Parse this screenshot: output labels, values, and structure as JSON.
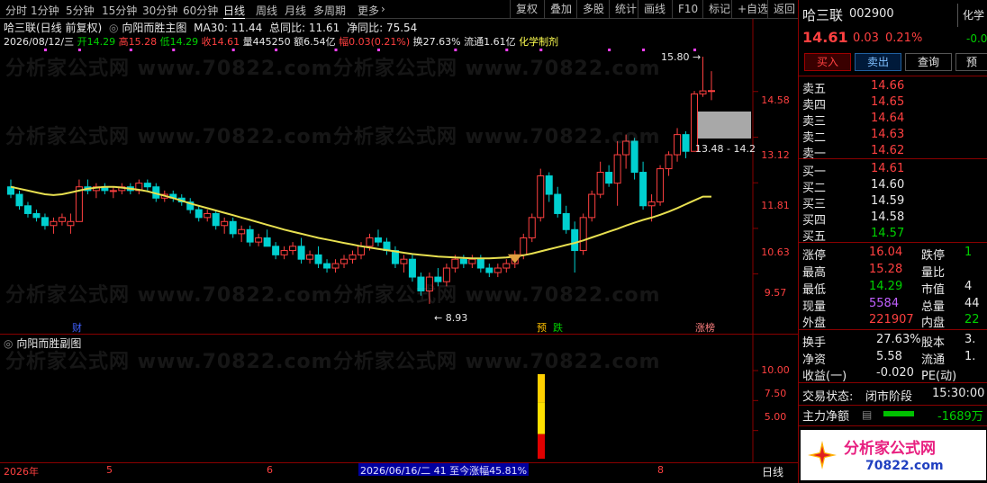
{
  "toolbar": {
    "timeframes": [
      "分时",
      "1分钟",
      "5分钟",
      "15分钟",
      "30分钟",
      "60分钟",
      "日线",
      "周线",
      "月线",
      "多周期",
      "更多"
    ],
    "active_timeframe": "日线",
    "buttons": [
      "复权",
      "叠加",
      "多股",
      "统计",
      "画线",
      "F10",
      "标记",
      "+自选",
      "返回"
    ]
  },
  "main": {
    "title": "哈三联(日线 前复权)",
    "indicator_name": "向阳而胜主图",
    "ma30": "MA30: 11.44",
    "total_ratio": "总同比: 11.61",
    "net_ratio": "净同比: 75.54",
    "info_date": "2026/08/12/三",
    "info_open_label": "开",
    "info_open": "14.29",
    "info_high_label": "高",
    "info_high": "15.28",
    "info_low_label": "低",
    "info_low": "14.29",
    "info_close_label": "收",
    "info_close": "14.61",
    "info_vol": "量445250",
    "info_amount": "额6.54亿",
    "info_amp": "幅0.03(0.21%)",
    "info_turnover": "换27.63%",
    "info_float": "流通1.61亿",
    "info_industry": "化学制剂",
    "y_labels": [
      "14.58",
      "13.12",
      "11.81",
      "10.63",
      "9.57"
    ],
    "high_marker": "15.80",
    "low_marker": "8.93",
    "range_label": "13.48 - 14.2",
    "tag_cai": "财",
    "tag_yu": "预",
    "tag_die": "跌",
    "tag_zhangbang": "涨榜"
  },
  "watermarks": [
    "分析家公式网 www.70822.com",
    "分析家公式网 www.70822.com",
    "分析家公式网 www.70822.com",
    "分析家公式网 www.70822.com",
    "分析家公式网 www.70822.com",
    "分析家公式网 www.70822.com",
    "分析家公式网 www.70822.com",
    "分析家公式网 www.70822.com"
  ],
  "sub": {
    "title": "向阳而胜副图",
    "y_labels": [
      "10.00",
      "7.50",
      "5.00"
    ]
  },
  "bottom": {
    "year_label": "2026年",
    "month_labels": [
      "5",
      "6",
      "8"
    ],
    "cursor_label": "2026/06/16/二 41 至今涨幅45.81%",
    "period": "日线"
  },
  "quote": {
    "name": "哈三联",
    "code": "002900",
    "price": "14.61",
    "change": "0.03",
    "change_pct": "0.21%",
    "buttons": [
      "买入",
      "卖出",
      "查询",
      "预"
    ],
    "side_tab": "化学",
    "side_tab_value": "-0.0",
    "sells": [
      {
        "label": "卖五",
        "price": "14.66"
      },
      {
        "label": "卖四",
        "price": "14.65"
      },
      {
        "label": "卖三",
        "price": "14.64"
      },
      {
        "label": "卖二",
        "price": "14.63"
      },
      {
        "label": "卖一",
        "price": "14.62"
      }
    ],
    "buys": [
      {
        "label": "买一",
        "price": "14.61"
      },
      {
        "label": "买二",
        "price": "14.60"
      },
      {
        "label": "买三",
        "price": "14.59"
      },
      {
        "label": "买四",
        "price": "14.58"
      },
      {
        "label": "买五",
        "price": "14.57"
      }
    ],
    "stats": [
      {
        "l1": "涨停",
        "v1": "16.04",
        "l2": "跌停",
        "v2": "1"
      },
      {
        "l1": "最高",
        "v1": "15.28",
        "l2": "量比",
        "v2": ""
      },
      {
        "l1": "最低",
        "v1": "14.29",
        "l2": "市值",
        "v2": "4"
      },
      {
        "l1": "现量",
        "v1": "5584",
        "l2": "总量",
        "v2": "44"
      },
      {
        "l1": "外盘",
        "v1": "221907",
        "l2": "内盘",
        "v2": "22"
      }
    ],
    "stats2": [
      {
        "l1": "换手",
        "v1": "27.63%",
        "l2": "股本",
        "v2": "3."
      },
      {
        "l1": "净资",
        "v1": "5.58",
        "l2": "流通",
        "v2": "1."
      },
      {
        "l1": "收益(一)",
        "v1": "-0.020",
        "l2": "PE(动)",
        "v2": ""
      }
    ],
    "trade_state_label": "交易状态:",
    "trade_state": "闭市阶段",
    "trade_time": "15:30:00",
    "main_flow_label": "主力净额",
    "main_flow": "-1689万"
  },
  "logo": {
    "text": "分析家公式网",
    "url_text": "70822.com"
  },
  "colors": {
    "up": "#ff4040",
    "down": "#00d0d0",
    "ma": "#e8e050",
    "border": "#8a0000"
  },
  "chart_data": {
    "type": "candlestick",
    "ma30_latest": 11.44,
    "high_marker": 15.8,
    "low_marker": 8.93,
    "candles": [
      [
        11.7,
        11.9,
        11.4,
        11.5
      ],
      [
        11.5,
        11.6,
        11.1,
        11.2
      ],
      [
        11.2,
        11.3,
        10.9,
        11.0
      ],
      [
        11.0,
        11.1,
        10.8,
        10.9
      ],
      [
        10.9,
        11.0,
        10.6,
        10.7
      ],
      [
        10.7,
        10.9,
        10.5,
        10.8
      ],
      [
        10.8,
        11.0,
        10.7,
        10.9
      ],
      [
        10.7,
        11.0,
        10.5,
        10.8
      ],
      [
        10.8,
        11.9,
        10.8,
        11.7
      ],
      [
        11.7,
        11.9,
        11.5,
        11.6
      ],
      [
        11.6,
        11.8,
        11.4,
        11.7
      ],
      [
        11.7,
        11.8,
        11.5,
        11.6
      ],
      [
        11.6,
        11.7,
        11.4,
        11.6
      ],
      [
        11.6,
        11.8,
        11.5,
        11.7
      ],
      [
        11.7,
        11.8,
        11.5,
        11.6
      ],
      [
        11.6,
        11.9,
        11.5,
        11.8
      ],
      [
        11.8,
        11.9,
        11.6,
        11.7
      ],
      [
        11.7,
        11.8,
        11.3,
        11.4
      ],
      [
        11.4,
        11.6,
        11.3,
        11.5
      ],
      [
        11.5,
        11.6,
        11.3,
        11.4
      ],
      [
        11.4,
        11.5,
        11.2,
        11.3
      ],
      [
        11.3,
        11.4,
        11.0,
        11.1
      ],
      [
        11.1,
        11.2,
        10.8,
        10.9
      ],
      [
        10.9,
        11.1,
        10.8,
        11.0
      ],
      [
        11.0,
        11.1,
        10.6,
        10.7
      ],
      [
        10.7,
        10.9,
        10.5,
        10.8
      ],
      [
        10.8,
        10.9,
        10.4,
        10.5
      ],
      [
        10.5,
        10.7,
        10.3,
        10.6
      ],
      [
        10.6,
        10.7,
        10.2,
        10.3
      ],
      [
        10.3,
        10.5,
        10.2,
        10.4
      ],
      [
        10.4,
        10.6,
        10.2,
        10.2
      ],
      [
        10.2,
        10.3,
        9.9,
        10.0
      ],
      [
        10.0,
        10.2,
        9.9,
        10.1
      ],
      [
        10.1,
        10.3,
        10.0,
        10.2
      ],
      [
        10.2,
        10.4,
        9.8,
        9.9
      ],
      [
        9.9,
        10.1,
        9.8,
        10.0
      ],
      [
        10.0,
        10.2,
        9.7,
        9.8
      ],
      [
        9.8,
        9.9,
        9.6,
        9.7
      ],
      [
        9.7,
        9.9,
        9.6,
        9.8
      ],
      [
        9.8,
        10.0,
        9.7,
        9.9
      ],
      [
        9.9,
        10.1,
        9.8,
        10.0
      ],
      [
        10.0,
        10.3,
        9.9,
        10.2
      ],
      [
        10.2,
        10.5,
        10.1,
        10.4
      ],
      [
        10.4,
        10.6,
        10.2,
        10.3
      ],
      [
        10.3,
        10.4,
        10.0,
        10.1
      ],
      [
        10.1,
        10.2,
        9.7,
        9.8
      ],
      [
        9.8,
        10.0,
        9.6,
        9.9
      ],
      [
        9.9,
        10.0,
        9.4,
        9.5
      ],
      [
        9.5,
        9.6,
        9.1,
        9.2
      ],
      [
        9.2,
        9.6,
        8.93,
        9.5
      ],
      [
        9.5,
        9.7,
        9.3,
        9.4
      ],
      [
        9.4,
        9.8,
        9.3,
        9.7
      ],
      [
        9.7,
        10.0,
        9.6,
        9.9
      ],
      [
        9.9,
        10.0,
        9.7,
        9.8
      ],
      [
        9.8,
        10.0,
        9.7,
        9.9
      ],
      [
        9.9,
        10.0,
        9.6,
        9.7
      ],
      [
        9.7,
        9.8,
        9.5,
        9.6
      ],
      [
        9.6,
        9.8,
        9.5,
        9.7
      ],
      [
        9.7,
        9.9,
        9.6,
        9.8
      ],
      [
        9.8,
        10.1,
        9.7,
        10.0
      ],
      [
        10.0,
        10.5,
        9.9,
        10.4
      ],
      [
        10.4,
        11.0,
        10.3,
        10.9
      ],
      [
        10.9,
        12.2,
        10.8,
        12.0
      ],
      [
        12.0,
        12.1,
        11.3,
        11.5
      ],
      [
        11.5,
        11.7,
        10.9,
        11.0
      ],
      [
        11.0,
        11.2,
        10.5,
        10.6
      ],
      [
        10.6,
        10.8,
        9.6,
        10.1
      ],
      [
        10.1,
        11.0,
        10.0,
        10.9
      ],
      [
        10.9,
        11.6,
        10.8,
        11.5
      ],
      [
        11.5,
        12.4,
        11.4,
        12.1
      ],
      [
        12.1,
        12.3,
        11.7,
        11.8
      ],
      [
        11.8,
        13.0,
        11.2,
        12.6
      ],
      [
        12.6,
        13.2,
        12.2,
        13.0
      ],
      [
        13.0,
        13.1,
        11.9,
        12.1
      ],
      [
        12.1,
        12.4,
        11.1,
        11.2
      ],
      [
        11.2,
        11.5,
        10.8,
        11.3
      ],
      [
        11.3,
        12.3,
        11.2,
        12.2
      ],
      [
        12.2,
        12.7,
        12.0,
        12.6
      ],
      [
        12.6,
        13.4,
        12.4,
        13.2
      ],
      [
        13.2,
        13.3,
        12.5,
        12.7
      ],
      [
        12.7,
        14.6,
        12.7,
        14.5
      ],
      [
        14.5,
        15.8,
        14.4,
        14.6
      ],
      [
        14.6,
        15.28,
        14.29,
        14.61
      ]
    ],
    "ma30": [
      11.7,
      11.65,
      11.6,
      11.55,
      11.5,
      11.48,
      11.5,
      11.55,
      11.6,
      11.65,
      11.68,
      11.7,
      11.7,
      11.68,
      11.65,
      11.62,
      11.58,
      11.52,
      11.46,
      11.4,
      11.33,
      11.26,
      11.2,
      11.14,
      11.08,
      11.02,
      10.96,
      10.9,
      10.84,
      10.78,
      10.72,
      10.66,
      10.6,
      10.55,
      10.5,
      10.45,
      10.4,
      10.36,
      10.32,
      10.28,
      10.24,
      10.2,
      10.17,
      10.14,
      10.11,
      10.08,
      10.05,
      10.02,
      10.0,
      9.98,
      9.96,
      9.95,
      9.94,
      9.93,
      9.92,
      9.92,
      9.92,
      9.93,
      9.94,
      9.96,
      9.99,
      10.03,
      10.08,
      10.13,
      10.18,
      10.23,
      10.28,
      10.34,
      10.41,
      10.48,
      10.55,
      10.62,
      10.7,
      10.77,
      10.84,
      10.9,
      10.97,
      11.05,
      11.14,
      11.24,
      11.34,
      11.44,
      11.44
    ],
    "sub_bar_value": 10.0,
    "sub_ylim": [
      2.5,
      11.5
    ]
  }
}
